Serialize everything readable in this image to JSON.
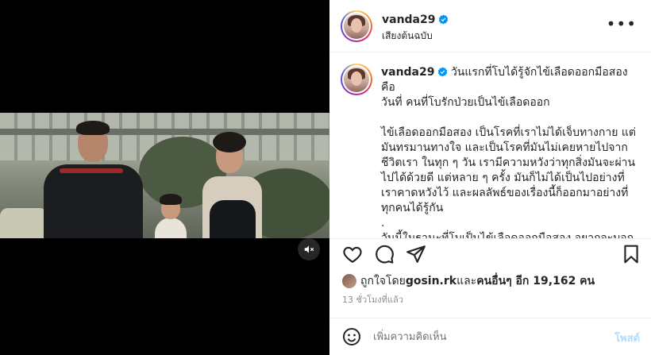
{
  "post": {
    "username": "vanda29",
    "audio_label": "เสียงต้นฉบับ",
    "more_label": "•••"
  },
  "caption": {
    "username": "vanda29",
    "text": " วันแรกที่โบได้รู้จักไข้เลือดออกมือสอง คือ\nวันที่ คนที่โบรักป่วยเป็นไข้เลือดออก\n\nไข้เลือดออกมือสอง เป็นโรคที่เราไม่ได้เจ็บทางกาย แต่\nมันทรมานทางใจ และเป็นโรคที่มันไม่เคยหายไปจาก\nชีวิตเรา ในทุก ๆ วัน เรามีความหวังว่าทุกสิ่งมันจะผ่าน\nไปได้ด้วยดี แต่หลาย ๆ ครั้ง มันก็ไม่ได้เป็นไปอย่างที่\nเราคาดหวังไว้ และผลลัพธ์ของเรื่องนี้ก็ออกมาอย่างที่\nทุกคนได้รู้กัน\n.\nวันนี้ในฐานะที่โบเป็นไข้เลือดออกมือสอง อยากจะบอก"
  },
  "likes": {
    "prefix": "ถูกใจโดย ",
    "user": "gosin.rk",
    "middle": " และ",
    "others": "คนอื่นๆ อีก 19,162 คน"
  },
  "timestamp": "13 ชั่วโมงที่แล้ว",
  "comment": {
    "placeholder": "เพิ่มความคิดเห็น",
    "post_label": "โพสต์"
  },
  "colors": {
    "verified": "#0095f6",
    "post_disabled": "#b3dbff"
  }
}
